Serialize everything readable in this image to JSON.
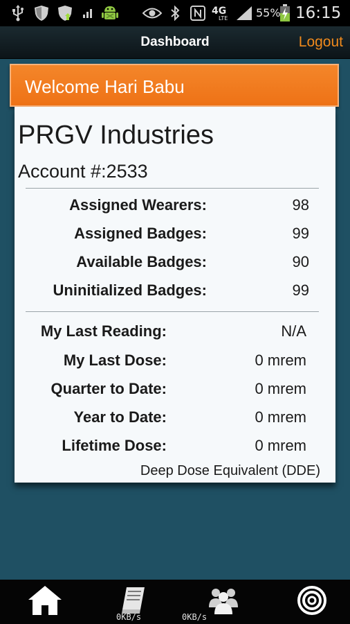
{
  "status_bar": {
    "battery_percent": "55%",
    "network_label": "4G",
    "network_sublabel": "LTE",
    "time": "16:15",
    "icons": [
      "usb-icon",
      "shield-icon",
      "shield-update-icon",
      "signal-small-icon",
      "android-debug-icon",
      "eye-icon",
      "bluetooth-icon",
      "nfc-icon",
      "network-4g-icon",
      "signal-icon",
      "battery-charging-icon"
    ]
  },
  "action_bar": {
    "title": "Dashboard",
    "logout_label": "Logout"
  },
  "welcome": {
    "text": "Welcome Hari Babu"
  },
  "account": {
    "company": "PRGV Industries",
    "account_number": "Account #:2533"
  },
  "badge_stats": [
    {
      "label": "Assigned Wearers:",
      "value": "98"
    },
    {
      "label": "Assigned Badges:",
      "value": "99"
    },
    {
      "label": "Available Badges:",
      "value": "90"
    },
    {
      "label": "Uninitialized Badges:",
      "value": "99"
    }
  ],
  "dose_stats": [
    {
      "label": "My Last Reading:",
      "value": "N/A"
    },
    {
      "label": "My Last Dose:",
      "value": "0 mrem"
    },
    {
      "label": "Quarter to Date:",
      "value": "0 mrem"
    },
    {
      "label": "Year to Date:",
      "value": "0 mrem"
    },
    {
      "label": "Lifetime Dose:",
      "value": "0 mrem"
    }
  ],
  "footnote": "Deep Dose Equivalent (DDE)",
  "bottom_nav": {
    "items": [
      {
        "icon": "home-icon"
      },
      {
        "icon": "book-icon",
        "caption": "0KB/s"
      },
      {
        "icon": "group-icon",
        "caption": "0KB/s"
      },
      {
        "icon": "target-icon"
      }
    ]
  },
  "colors": {
    "background": "#1f5063",
    "accent": "#f08a1c",
    "banner": "#f27a1e",
    "card": "#f6f9fb"
  }
}
